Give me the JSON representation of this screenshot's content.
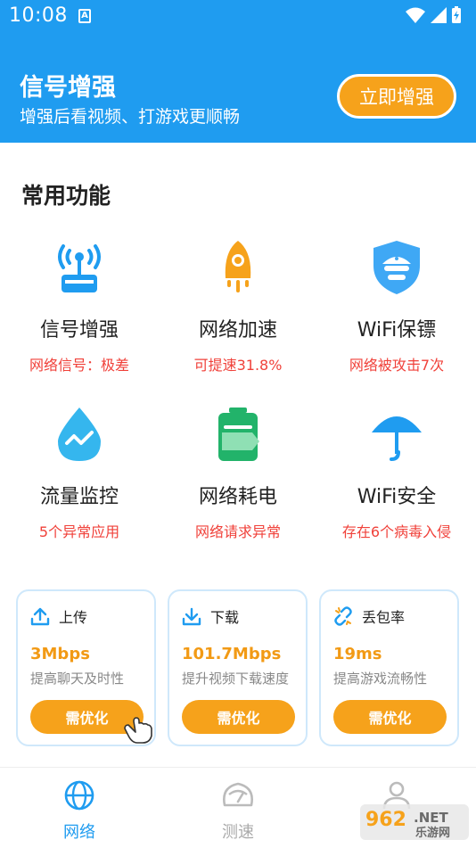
{
  "status_bar": {
    "time": "10:08",
    "notif_letter": "A"
  },
  "header": {
    "title": "信号增强",
    "subtitle": "增强后看视频、打游戏更顺畅",
    "boost_button": "立即增强"
  },
  "common": {
    "title": "常用功能"
  },
  "features": [
    {
      "name": "信号增强",
      "desc": "网络信号：极差",
      "icon": "router-signal-icon"
    },
    {
      "name": "网络加速",
      "desc": "可提速31.8%",
      "icon": "rocket-icon"
    },
    {
      "name": "WiFi保镖",
      "desc": "网络被攻击7次",
      "icon": "shield-guard-icon"
    },
    {
      "name": "流量监控",
      "desc": "5个异常应用",
      "icon": "water-drop-icon"
    },
    {
      "name": "网络耗电",
      "desc": "网络请求异常",
      "icon": "battery-icon"
    },
    {
      "name": "WiFi安全",
      "desc": "存在6个病毒入侵",
      "icon": "umbrella-icon"
    }
  ],
  "cards": [
    {
      "label": "上传",
      "value": "3Mbps",
      "desc": "提高聊天及时性",
      "button": "需优化",
      "icon": "upload-icon"
    },
    {
      "label": "下载",
      "value": "101.7Mbps",
      "desc": "提升视频下载速度",
      "button": "需优化",
      "icon": "download-icon"
    },
    {
      "label": "丢包率",
      "value": "19ms",
      "desc": "提高游戏流畅性",
      "button": "需优化",
      "icon": "broken-link-icon"
    }
  ],
  "nav": [
    {
      "label": "网络",
      "icon": "globe-icon",
      "active": true
    },
    {
      "label": "测速",
      "icon": "speedometer-icon",
      "active": false
    },
    {
      "label": "",
      "icon": "profile-icon",
      "active": false
    }
  ],
  "watermark": {
    "text1": "962",
    "text2": ".NET",
    "text3": "乐游网"
  },
  "colors": {
    "primary": "#1f9cf0",
    "accent": "#f6a21b",
    "warning": "#f0413a",
    "value": "#f29a15"
  }
}
